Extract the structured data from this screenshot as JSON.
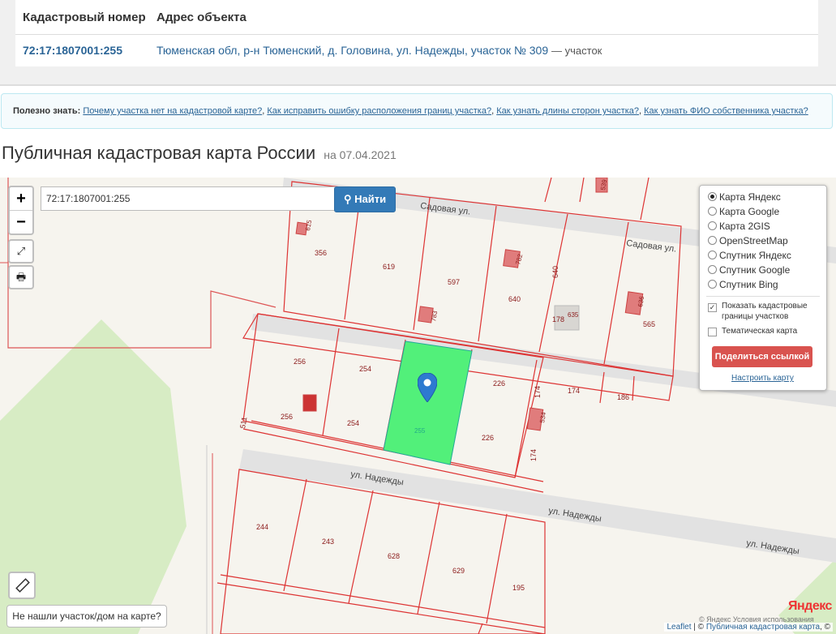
{
  "table": {
    "col_cad": "Кадастровый номер",
    "col_addr": "Адрес объекта",
    "cad_number": "72:17:1807001:255",
    "address": "Тюменская обл, р-н Тюменский, д. Головина, ул. Надежды, участок № 309",
    "address_note": "— участок"
  },
  "tips": {
    "lead": "Полезно знать:",
    "links": [
      "Почему участка нет на кадастровой карте?",
      "Как исправить ошибку расположения границ участка?",
      "Как узнать длины сторон участка?",
      "Как узнать ФИО собственника участка?"
    ]
  },
  "title": {
    "main": "Публичная кадастровая карта России",
    "date": "на 07.04.2021"
  },
  "map": {
    "zoom_in": "+",
    "zoom_out": "−",
    "search_value": "72:17:1807001:255",
    "search_button": "Найти",
    "layers": [
      "Карта Яндекс",
      "Карта Google",
      "Карта 2GIS",
      "OpenStreetMap",
      "Спутник Яндекс",
      "Спутник Google",
      "Спутник Bing"
    ],
    "selected_layer": "Карта Яндекс",
    "show_borders_label": "Показать кадастровые границы участков",
    "thematic_label": "Тематическая карта",
    "share_button": "Поделиться ссылкой",
    "setup_link": "Настроить карту",
    "not_found_button": "Не нашли участок/дом на карте?",
    "attribution_leaflet": "Leaflet",
    "attribution_pkk": "Публичная кадастровая карта",
    "attribution_sep": " | © ",
    "attribution_tail": ", ©",
    "yandex_logo": "Яндекс",
    "yandex_legal": "© Яндекс  Условия использования",
    "street_labels": [
      "Садовая ул.",
      "Садовая ул.",
      "ул. Надежды",
      "ул. Надежды",
      "ул. Надежды"
    ],
    "parcel_labels": [
      "356",
      "619",
      "597",
      "640",
      "565",
      "256",
      "254",
      "226",
      "174",
      "186",
      "256",
      "254",
      "255",
      "226",
      "174",
      "244",
      "243",
      "628",
      "629",
      "195",
      "615",
      "782",
      "783",
      "640",
      "178",
      "635",
      "636",
      "534",
      "511",
      "539"
    ]
  },
  "colors": {
    "selected_parcel": "#52f07a",
    "parcel_border": "#d33",
    "park": "#d7ecc4",
    "link": "#2a6496",
    "share": "#d9534f",
    "search_btn": "#337ab7"
  }
}
